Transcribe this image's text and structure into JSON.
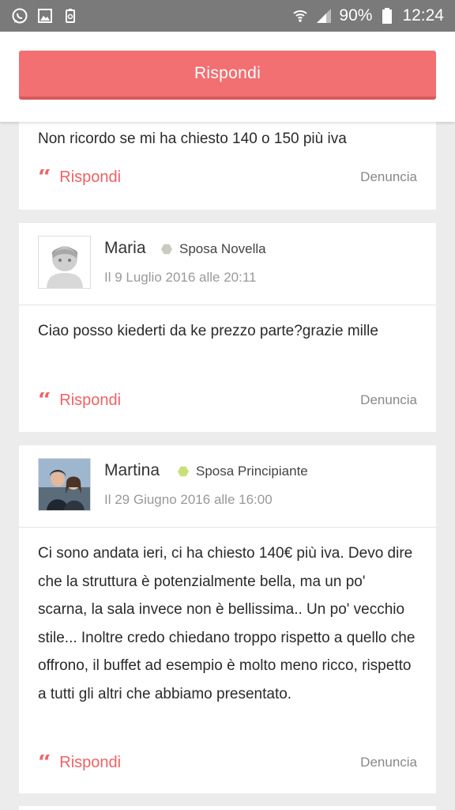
{
  "status_bar": {
    "battery": "90%",
    "time": "12:24",
    "icons_left": [
      "whatsapp-icon",
      "gallery-icon",
      "recycle-icon"
    ],
    "icons_right": [
      "wifi-icon",
      "signal-icon",
      "battery-icon"
    ]
  },
  "toolbar": {
    "reply_label": "Rispondi"
  },
  "posts": [
    {
      "text": "Non ricordo se mi ha chiesto 140 o 150 più iva",
      "reply": "Rispondi",
      "report": "Denuncia"
    },
    {
      "author": "Maria",
      "rank": "Sposa Novella",
      "rank_color": "#c8cbbd",
      "date": "Il 9 Luglio 2016 alle 20:11",
      "text": "Ciao posso kiederti da ke prezzo parte?grazie mille",
      "reply": "Rispondi",
      "report": "Denuncia"
    },
    {
      "author": "Martina",
      "rank": "Sposa Principiante",
      "rank_color": "#c9e07a",
      "date": "Il 29 Giugno 2016 alle 16:00",
      "text": "Ci sono andata ieri, ci ha chiesto 140€ più iva. Devo dire che la struttura è potenzialmente bella, ma un po' scarna, la sala invece non è bellissima.. Un po' vecchio stile... Inoltre credo chiedano troppo rispetto a quello che offrono, il buffet ad esempio è molto meno ricco, rispetto a tutti gli altri che abbiamo presentato.",
      "reply": "Rispondi",
      "report": "Denuncia"
    }
  ],
  "colors": {
    "accent": "#f26f72",
    "status_bar": "#7a7a7a",
    "background": "#ececec"
  }
}
